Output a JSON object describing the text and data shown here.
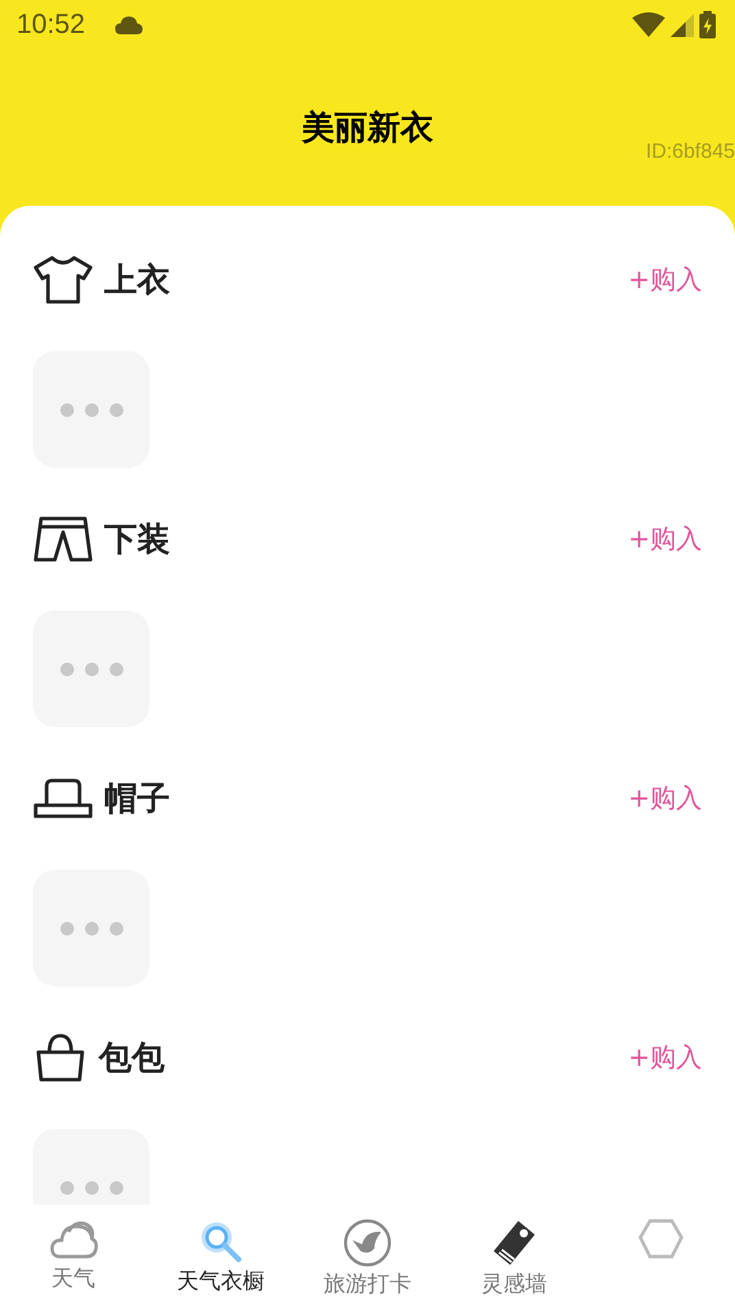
{
  "status_bar": {
    "time": "10:52"
  },
  "header": {
    "title": "美丽新衣",
    "id_label": "ID:6bf845"
  },
  "sections": [
    {
      "kind": "top",
      "title": "上衣",
      "action": "+购入"
    },
    {
      "kind": "bottom",
      "title": "下装",
      "action": "+购入"
    },
    {
      "kind": "hat",
      "title": "帽子",
      "action": "+购入"
    },
    {
      "kind": "bag",
      "title": "包包",
      "action": "+购入"
    }
  ],
  "tabs": [
    {
      "kind": "weather",
      "label": "天气",
      "selected": false
    },
    {
      "kind": "wardrobe",
      "label": "天气衣橱",
      "selected": true
    },
    {
      "kind": "travel",
      "label": "旅游打卡",
      "selected": false
    },
    {
      "kind": "tag",
      "label": "灵感墙",
      "selected": false
    },
    {
      "kind": "hanger",
      "selected": false
    }
  ]
}
